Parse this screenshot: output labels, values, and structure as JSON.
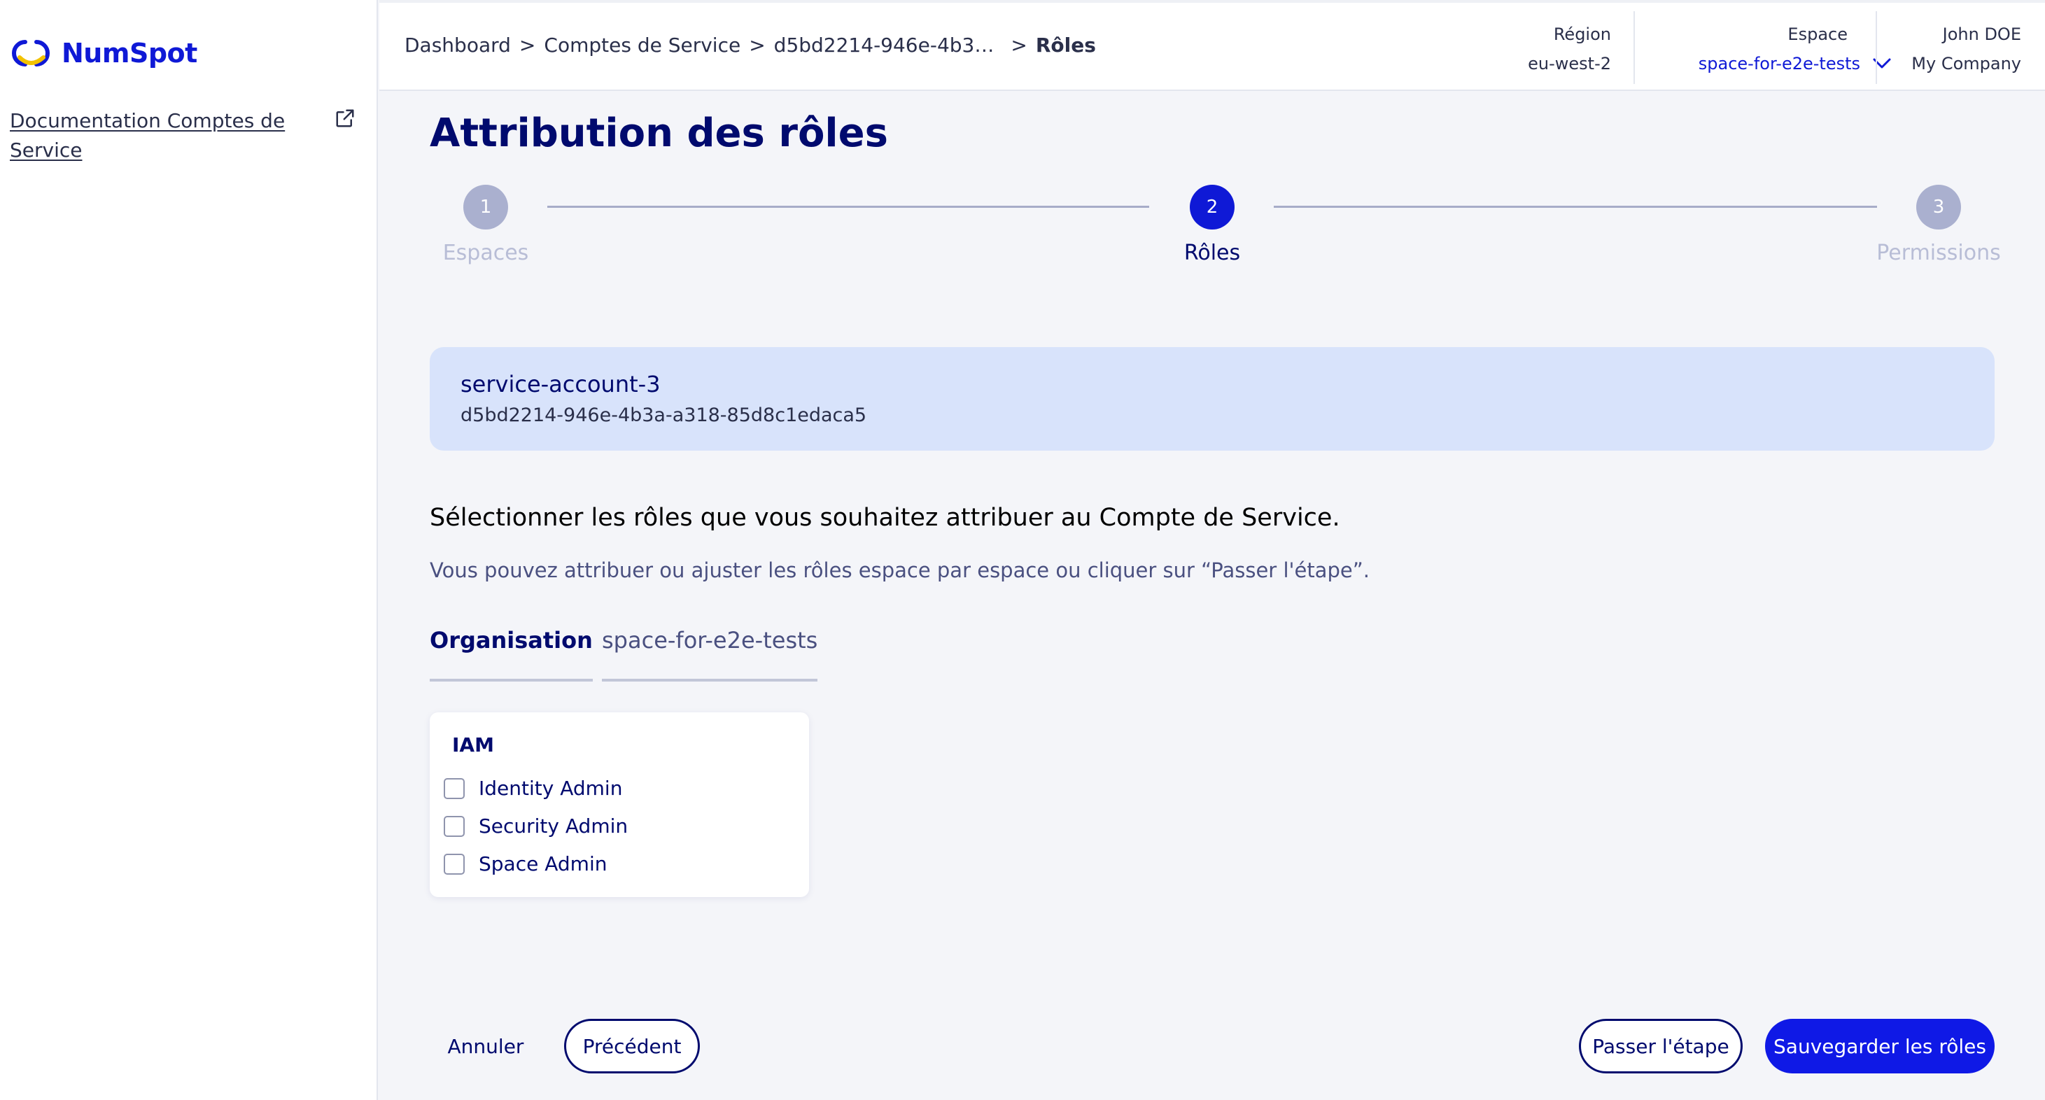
{
  "brand": {
    "name": "NumSpot"
  },
  "sidebar": {
    "doc_link": "Documentation Comptes de Service"
  },
  "header": {
    "breadcrumb": [
      "Dashboard",
      "Comptes de Service",
      "d5bd2214-946e-4b3…",
      "Rôles"
    ],
    "separator": ">",
    "region": {
      "label": "Région",
      "value": "eu-west-2"
    },
    "space": {
      "label": "Espace",
      "value": "space-for-e2e-tests"
    },
    "user": {
      "name": "John DOE",
      "company": "My Company"
    }
  },
  "page": {
    "title": "Attribution des rôles"
  },
  "stepper": {
    "steps": [
      {
        "number": "1",
        "label": "Espaces",
        "state": "inactive"
      },
      {
        "number": "2",
        "label": "Rôles",
        "state": "active"
      },
      {
        "number": "3",
        "label": "Permissions",
        "state": "inactive"
      }
    ]
  },
  "service_account": {
    "name": "service-account-3",
    "id": "d5bd2214-946e-4b3a-a318-85d8c1edaca5"
  },
  "instructions": {
    "main": "Sélectionner les rôles que vous souhaitez attribuer au Compte de Service.",
    "sub": "Vous pouvez attribuer ou ajuster les rôles espace par espace ou cliquer sur “Passer l'étape”."
  },
  "tabs": [
    {
      "label": "Organisation",
      "active": true
    },
    {
      "label": "space-for-e2e-tests",
      "active": false
    }
  ],
  "role_group": {
    "title": "IAM",
    "roles": [
      {
        "label": "Identity Admin",
        "checked": false
      },
      {
        "label": "Security Admin",
        "checked": false
      },
      {
        "label": "Space Admin",
        "checked": false
      }
    ]
  },
  "footer": {
    "cancel": "Annuler",
    "previous": "Précédent",
    "skip": "Passer l'étape",
    "save": "Sauvegarder les rôles"
  },
  "colors": {
    "primary": "#0f19d6",
    "navy": "#000a6e",
    "card_bg": "#d8e3fb",
    "step_inactive": "#aab0cf"
  }
}
